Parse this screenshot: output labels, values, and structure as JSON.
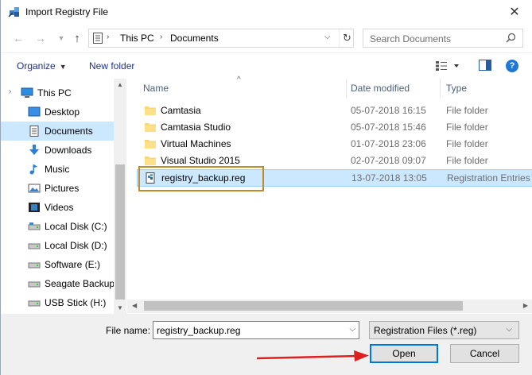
{
  "window": {
    "title": "Import Registry File",
    "close_glyph": "✕"
  },
  "nav": {
    "back_icon": "arrow-left-icon",
    "forward_icon": "arrow-right-icon",
    "up_icon": "arrow-up-icon",
    "breadcrumb": [
      "This PC",
      "Documents"
    ],
    "search_placeholder": "Search Documents"
  },
  "toolbar": {
    "organize_label": "Organize",
    "new_folder_label": "New folder",
    "help_label": "?"
  },
  "sidebar": {
    "items": [
      {
        "label": "This PC",
        "icon": "computer-icon"
      },
      {
        "label": "Desktop",
        "icon": "desktop-icon"
      },
      {
        "label": "Documents",
        "icon": "documents-icon",
        "selected": true
      },
      {
        "label": "Downloads",
        "icon": "downloads-icon"
      },
      {
        "label": "Music",
        "icon": "music-icon"
      },
      {
        "label": "Pictures",
        "icon": "pictures-icon"
      },
      {
        "label": "Videos",
        "icon": "videos-icon"
      },
      {
        "label": "Local Disk (C:)",
        "icon": "drive-icon"
      },
      {
        "label": "Local Disk (D:)",
        "icon": "drive-icon"
      },
      {
        "label": "Software (E:)",
        "icon": "drive-icon"
      },
      {
        "label": "Seagate Backup",
        "icon": "drive-icon"
      },
      {
        "label": "USB Stick (H:)",
        "icon": "drive-icon"
      }
    ]
  },
  "filelist": {
    "columns": [
      "Name",
      "Date modified",
      "Type"
    ],
    "rows": [
      {
        "name": "Camtasia",
        "date": "05-07-2018 16:15",
        "type": "File folder",
        "icon": "folder-icon"
      },
      {
        "name": "Camtasia Studio",
        "date": "05-07-2018 15:46",
        "type": "File folder",
        "icon": "folder-icon"
      },
      {
        "name": "Virtual Machines",
        "date": "01-07-2018 23:06",
        "type": "File folder",
        "icon": "folder-icon"
      },
      {
        "name": "Visual Studio 2015",
        "date": "02-07-2018 09:07",
        "type": "File folder",
        "icon": "folder-icon"
      },
      {
        "name": "registry_backup.reg",
        "date": "13-07-2018 13:05",
        "type": "Registration Entries",
        "icon": "reg-file-icon",
        "selected": true
      }
    ]
  },
  "footer": {
    "file_name_label": "File name:",
    "file_name_value": "registry_backup.reg",
    "filter_value": "Registration Files (*.reg)",
    "open_label": "Open",
    "cancel_label": "Cancel"
  },
  "colors": {
    "selection": "#cce8ff",
    "link_blue": "#1e3287",
    "highlight_border": "#c48a2a",
    "annotation_arrow": "#e02020"
  }
}
